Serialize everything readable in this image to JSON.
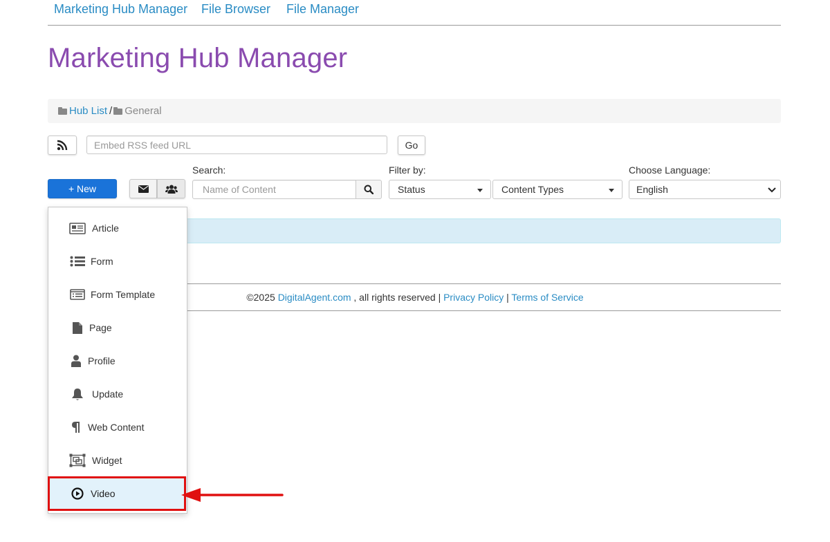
{
  "nav": {
    "links": [
      "Marketing Hub Manager",
      "File Browser",
      "File Manager"
    ]
  },
  "page": {
    "title": "Marketing Hub Manager"
  },
  "breadcrumb": {
    "hub_list": "Hub List",
    "separator": "/",
    "current": "General"
  },
  "rss": {
    "placeholder": "Embed RSS feed URL",
    "go_label": "Go"
  },
  "toolbar": {
    "new_label": "+ New",
    "search_label": "Search:",
    "search_placeholder": "Name of Content",
    "filter_label": "Filter by:",
    "status_select": "Status",
    "content_types_select": "Content Types",
    "language_label": "Choose Language:",
    "language_value": "English"
  },
  "new_menu": {
    "items": [
      {
        "label": "Article",
        "icon": "newspaper-icon"
      },
      {
        "label": "Form",
        "icon": "list-icon"
      },
      {
        "label": "Form Template",
        "icon": "list-alt-icon"
      },
      {
        "label": "Page",
        "icon": "file-icon"
      },
      {
        "label": "Profile",
        "icon": "user-icon"
      },
      {
        "label": "Update",
        "icon": "bell-icon"
      },
      {
        "label": "Web Content",
        "icon": "paragraph-icon"
      },
      {
        "label": "Widget",
        "icon": "object-group-icon"
      },
      {
        "label": "Video",
        "icon": "play-circle-icon"
      }
    ],
    "highlighted": "Video"
  },
  "footer": {
    "copyright": "©2025",
    "site": "DigitalAgent.com",
    "rights": ", all rights reserved |",
    "privacy": "Privacy Policy",
    "sep": "|",
    "terms": "Terms of Service"
  },
  "colors": {
    "link": "#2a8cc4",
    "title": "#8a4baf",
    "primary": "#1a73d9",
    "alert_bg": "#d9edf7",
    "highlight_border": "#e01010",
    "annotation_arrow": "#e01010"
  }
}
